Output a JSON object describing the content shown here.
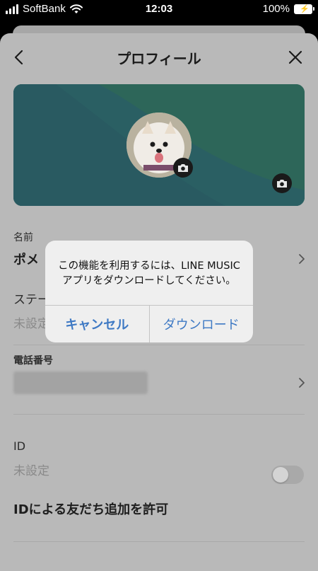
{
  "status_bar": {
    "carrier": "SoftBank",
    "time": "12:03",
    "battery": "100%"
  },
  "nav": {
    "title": "プロフィール"
  },
  "fields": {
    "name": {
      "label": "名前",
      "value": "ポメ"
    },
    "status": {
      "label": "ステー",
      "value": "未設定"
    },
    "phone": {
      "label": "電話番号"
    },
    "id": {
      "label": "ID",
      "value": "未設定"
    },
    "allow_add": {
      "label": "IDによる友だち追加を許可",
      "enabled": false
    }
  },
  "dialog": {
    "message": "この機能を利用するには、LINE MUSICアプリをダウンロードしてください。",
    "cancel": "キャンセル",
    "download": "ダウンロード"
  },
  "colors": {
    "accent": "#3e79c4",
    "cover": "#2c675a"
  }
}
